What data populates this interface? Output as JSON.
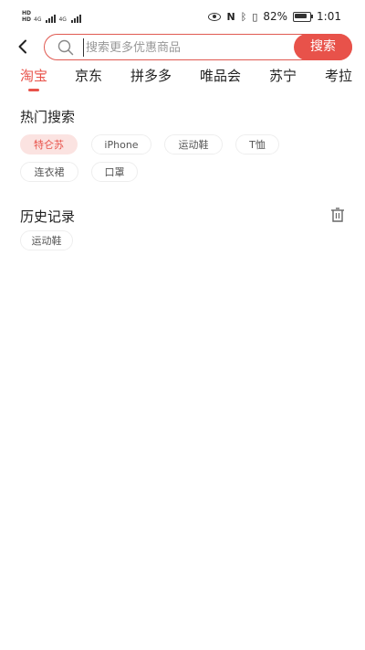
{
  "status_bar": {
    "network_left": "HD",
    "network_left_2": "HD",
    "net_type_1": "4G",
    "net_type_2": "4G",
    "battery": "82%",
    "time": "1:01"
  },
  "header": {
    "search_placeholder": "搜索更多优惠商品",
    "search_button": "搜索"
  },
  "tabs": [
    {
      "label": "淘宝",
      "active": true
    },
    {
      "label": "京东",
      "active": false
    },
    {
      "label": "拼多多",
      "active": false
    },
    {
      "label": "唯品会",
      "active": false
    },
    {
      "label": "苏宁",
      "active": false
    },
    {
      "label": "考拉",
      "active": false
    }
  ],
  "hot_search": {
    "title": "热门搜索",
    "items": [
      "特仑苏",
      "iPhone",
      "运动鞋",
      "T恤",
      "连衣裙",
      "口罩"
    ]
  },
  "history": {
    "title": "历史记录",
    "items": [
      "运动鞋"
    ]
  },
  "colors": {
    "accent": "#e8524a",
    "hot_chip_bg": "#fbe3e1"
  }
}
